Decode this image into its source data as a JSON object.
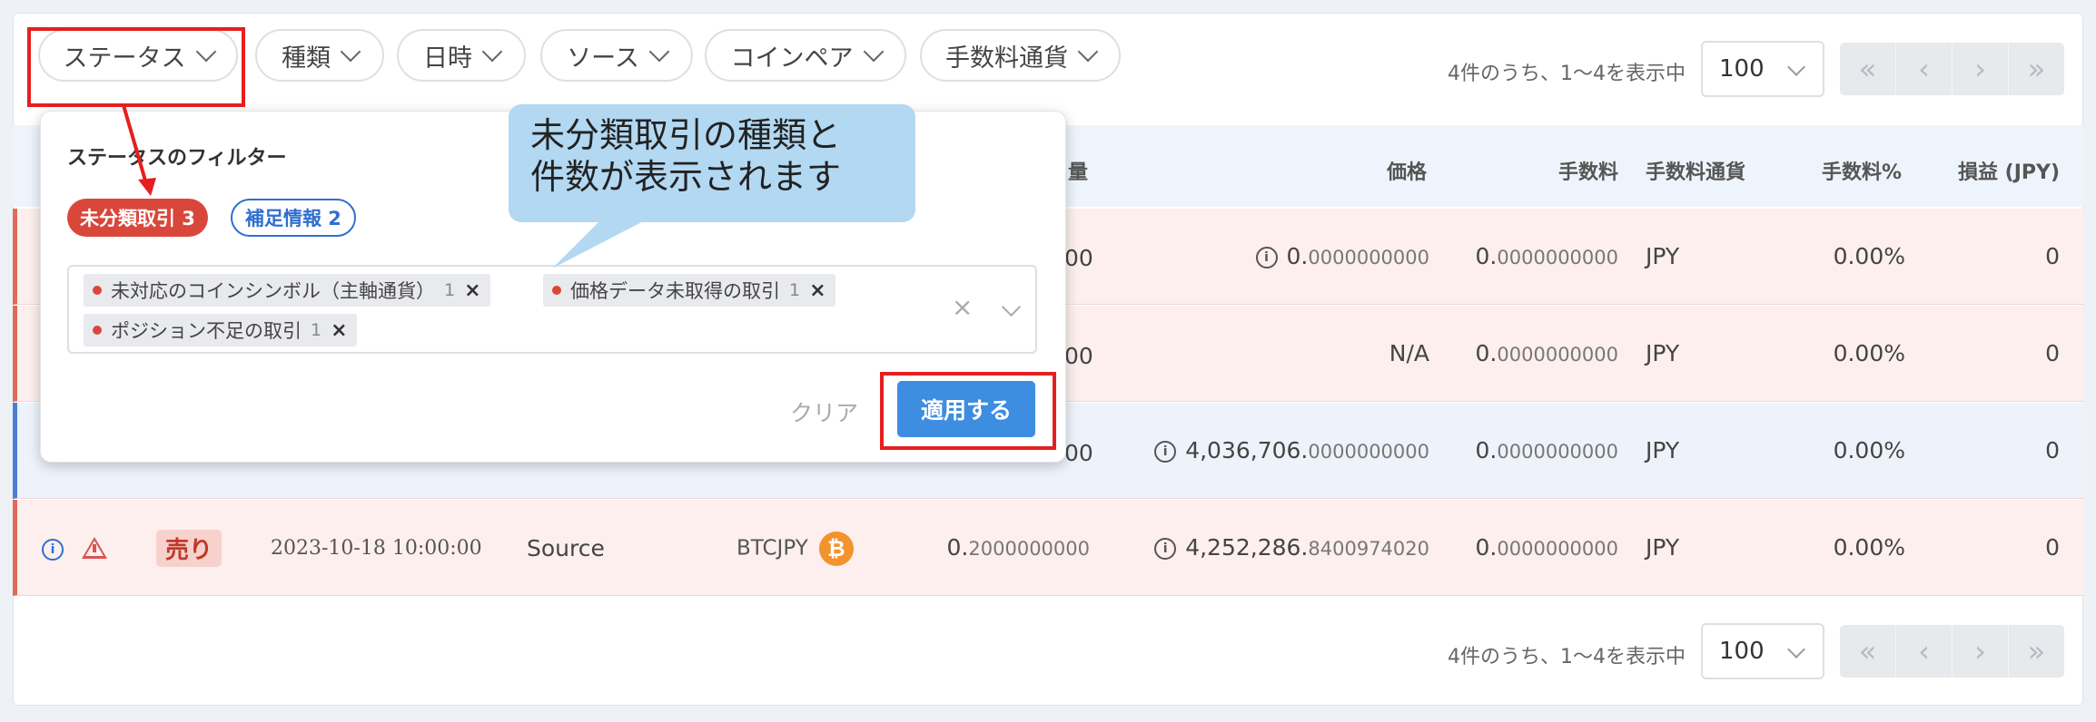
{
  "filters": [
    "ステータス",
    "種類",
    "日時",
    "ソース",
    "コインペア",
    "手数料通貨"
  ],
  "pager": {
    "summary": "4件のうち、1〜4を表示中",
    "per_page": "100",
    "first": "«",
    "prev": "‹",
    "next": "›",
    "last": "»"
  },
  "table": {
    "headers": {
      "qty": "量",
      "price": "価格",
      "fee": "手数料",
      "fee_currency": "手数料通貨",
      "fee_pct": "手数料%",
      "pnl": "損益 (JPY)"
    },
    "rows": [
      {
        "qty_tail": "00",
        "price_int": "0.",
        "price_dec": "0000000000",
        "fee_int": "0.",
        "fee_dec": "0000000000",
        "fee_currency": "JPY",
        "fee_pct": "0.00%",
        "pnl": "0"
      },
      {
        "qty_tail": "00",
        "price_text": "N/A",
        "fee_int": "0.",
        "fee_dec": "0000000000",
        "fee_currency": "JPY",
        "fee_pct": "0.00%",
        "pnl": "0"
      },
      {
        "qty_tail": "00",
        "price_int": "4,036,706.",
        "price_dec": "0000000000",
        "fee_int": "0.",
        "fee_dec": "0000000000",
        "fee_currency": "JPY",
        "fee_pct": "0.00%",
        "pnl": "0"
      },
      {
        "type": "売り",
        "datetime": "2023-10-18 10:00:00",
        "source": "Source",
        "pair": "BTCJPY",
        "qty_int": "0.",
        "qty_dec": "2000000000",
        "price_int": "4,252,286.",
        "price_dec": "8400974020",
        "fee_int": "0.",
        "fee_dec": "0000000000",
        "fee_currency": "JPY",
        "fee_pct": "0.00%",
        "pnl": "0"
      }
    ]
  },
  "popover": {
    "title": "ステータスのフィルター",
    "chip_unclassified": "未分類取引 3",
    "chip_supplement": "補足情報 2",
    "tags": [
      {
        "label": "未対応のコインシンボル（主軸通貨）",
        "count": "1"
      },
      {
        "label": "価格データ未取得の取引",
        "count": "1"
      },
      {
        "label": "ポジション不足の取引",
        "count": "1"
      }
    ],
    "clear": "クリア",
    "apply": "適用する"
  },
  "callout": {
    "line1": "未分類取引の種類と",
    "line2": "件数が表示されます"
  },
  "colors": {
    "accent": "#3d8de0",
    "danger": "#d9473b",
    "annotation": "#e51f1f",
    "callout": "#b3d8f2"
  }
}
